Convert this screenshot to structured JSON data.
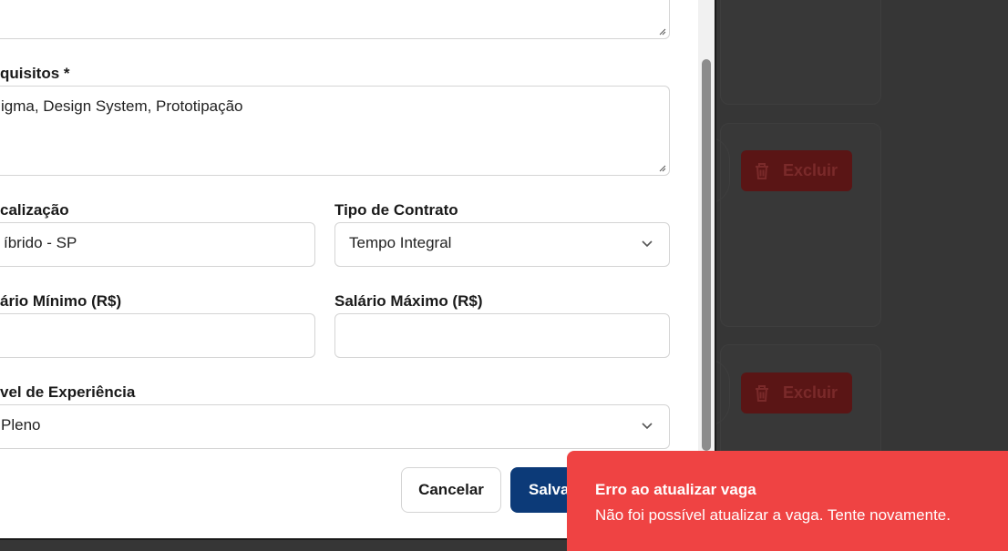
{
  "form": {
    "requirements_label": "quisitos *",
    "requirements_value": "igma, Design System, Prototipação",
    "location_label": "calização",
    "location_value": "íbrido - SP",
    "contract_label": "Tipo de Contrato",
    "contract_value": "Tempo Integral",
    "salary_min_label": "ário Mínimo (R$)",
    "salary_min_value": "",
    "salary_max_label": "Salário Máximo (R$)",
    "salary_max_value": "",
    "experience_label": "vel de Experiência",
    "experience_value": "Pleno"
  },
  "actions": {
    "cancel_label": "Cancelar",
    "save_label": "Salva"
  },
  "background": {
    "delete_label": "Excluir"
  },
  "toast": {
    "title": "Erro ao atualizar vaga",
    "description": "Não foi possível atualizar a vaga. Tente novamente."
  },
  "colors": {
    "primary": "#0c3a78",
    "error": "#ef4343",
    "delete_bg": "#5a1515"
  },
  "icons": [
    "trash-icon",
    "chevron-down-icon",
    "resize-handle-icon"
  ]
}
